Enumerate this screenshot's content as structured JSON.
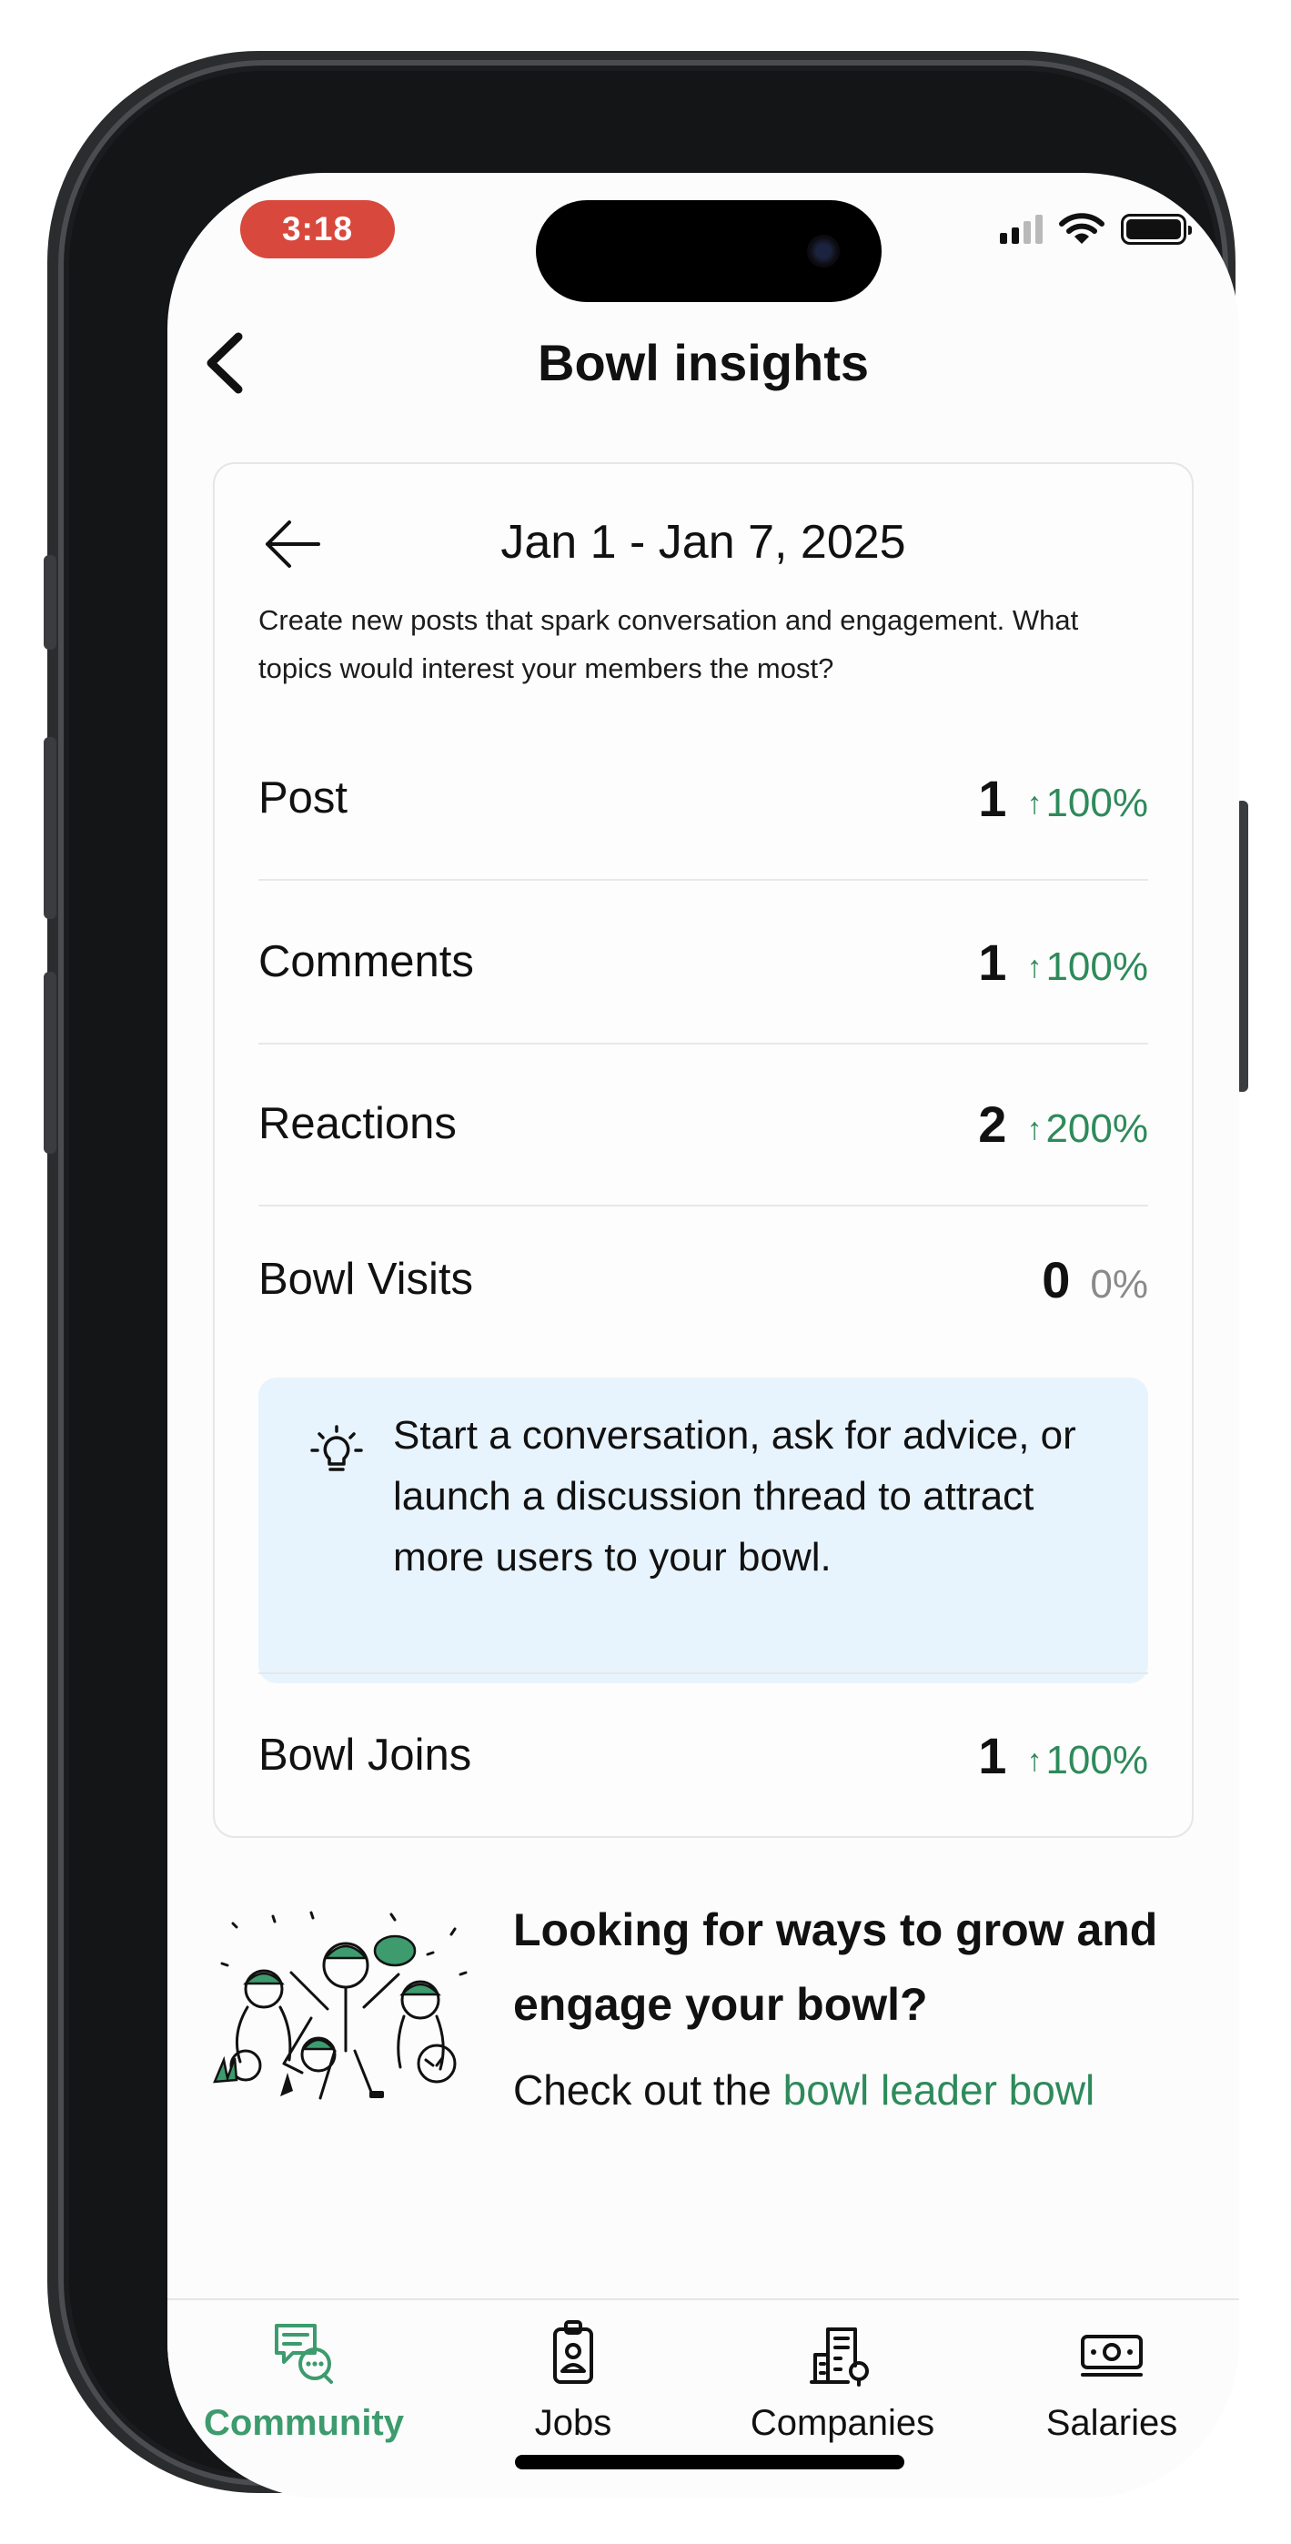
{
  "status_bar": {
    "time": "3:18"
  },
  "header": {
    "title": "Bowl insights"
  },
  "insights": {
    "date_range": "Jan 1 - Jan 7, 2025",
    "hint": "Create new posts that spark conversation and engagement. What topics would interest your members the most?",
    "metrics": [
      {
        "label": "Post",
        "value": "1",
        "change": "100%",
        "direction": "up"
      },
      {
        "label": "Comments",
        "value": "1",
        "change": "100%",
        "direction": "up"
      },
      {
        "label": "Reactions",
        "value": "2",
        "change": "200%",
        "direction": "up"
      },
      {
        "label": "Bowl Visits",
        "value": "0",
        "change": "0%",
        "direction": "none"
      },
      {
        "label": "Bowl Joins",
        "value": "1",
        "change": "100%",
        "direction": "up"
      }
    ],
    "tip": "Start a conversation, ask for advice, or launch a discussion thread to attract more users to your bowl."
  },
  "promo": {
    "title": "Looking for ways to grow and engage your bowl?",
    "prefix": "Check out the ",
    "link": "bowl leader bowl"
  },
  "tabs": [
    {
      "label": "Community",
      "icon": "community-chat-icon",
      "active": true
    },
    {
      "label": "Jobs",
      "icon": "badge-icon",
      "active": false
    },
    {
      "label": "Companies",
      "icon": "building-icon",
      "active": false
    },
    {
      "label": "Salaries",
      "icon": "cash-icon",
      "active": false
    }
  ],
  "colors": {
    "accent": "#2e8a5a",
    "tip_bg": "#e8f4fd",
    "time_pill": "#d8483c"
  }
}
